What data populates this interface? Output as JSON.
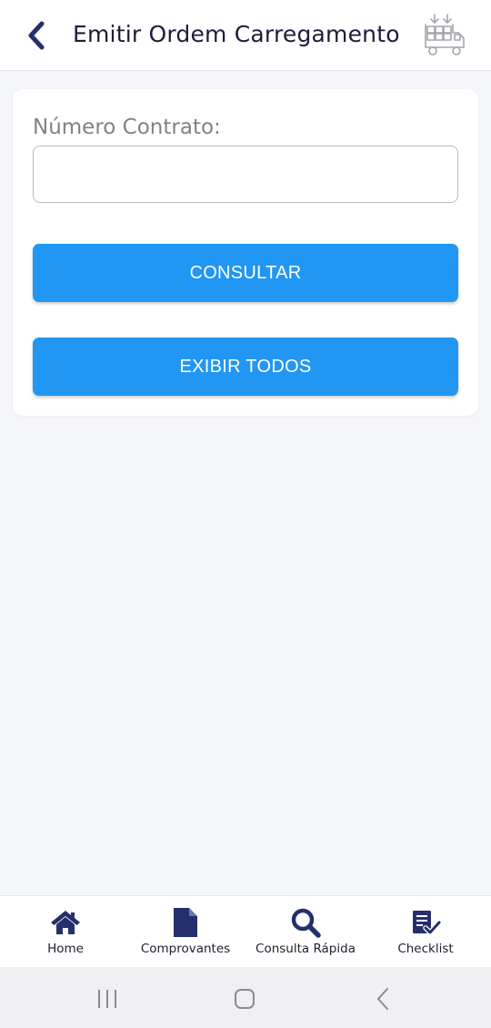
{
  "header": {
    "title": "Emitir Ordem Carregamento",
    "back_icon": "chevron-left-icon",
    "logo_icon": "loading-truck-icon"
  },
  "form": {
    "field_label": "Número Contrato:",
    "field_value": "",
    "consultar_label": "CONSULTAR",
    "exibir_todos_label": "EXIBIR TODOS"
  },
  "bottom_nav": {
    "items": [
      {
        "label": "Home",
        "icon": "home-icon"
      },
      {
        "label": "Comprovantes",
        "icon": "document-icon"
      },
      {
        "label": "Consulta Rápida",
        "icon": "search-icon"
      },
      {
        "label": "Checklist",
        "icon": "checklist-icon"
      }
    ]
  },
  "system_nav": {
    "icons": [
      "recent-apps-icon",
      "home-circle-icon",
      "back-icon"
    ]
  },
  "colors": {
    "primary": "#2196f3",
    "navy": "#24306b",
    "background": "#f5f6fa"
  }
}
